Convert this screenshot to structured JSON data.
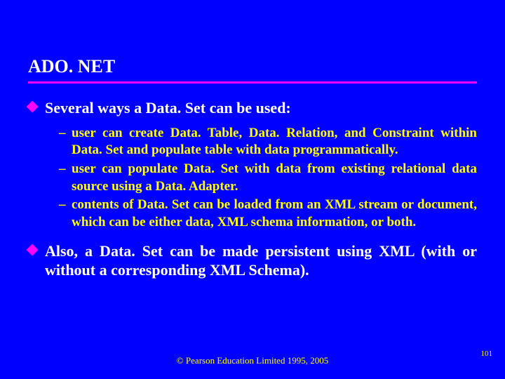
{
  "title": "ADO. NET",
  "bullets": [
    "Several ways a Data. Set can be used:",
    "Also, a Data. Set can be made persistent using XML (with or without a corresponding XML Schema)."
  ],
  "sub_bullets": [
    "user can create Data. Table, Data. Relation, and Constraint within Data. Set and populate table with data programmatically.",
    "user can populate Data. Set with data from existing relational data source using a Data. Adapter.",
    "contents of Data. Set can be loaded from an XML stream or document, which can be either data, XML schema information, or both."
  ],
  "footer": "© Pearson Education Limited 1995, 2005",
  "page_num": "101"
}
